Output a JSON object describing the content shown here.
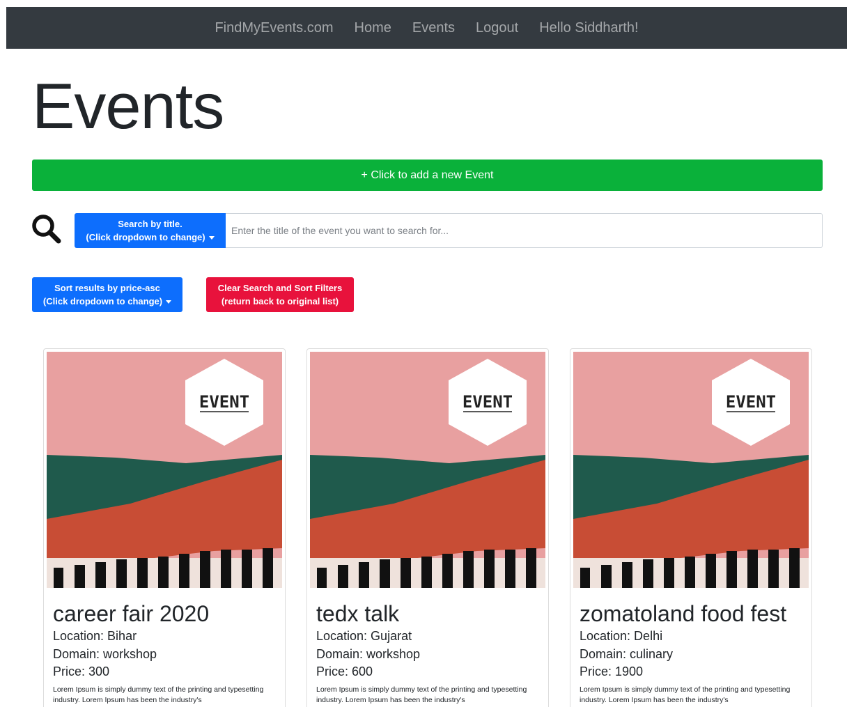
{
  "navbar": {
    "brand": "FindMyEvents.com",
    "links": [
      "Home",
      "Events",
      "Logout"
    ],
    "greeting": "Hello Siddharth!"
  },
  "page": {
    "title": "Events",
    "add_button_label": "+ Click to add a new Event"
  },
  "search": {
    "icon": "search-icon",
    "dropdown_line1": "Search by title.",
    "dropdown_line2": "(Click dropdown to change)",
    "placeholder": "Enter the title of the event you want to search for..."
  },
  "sort": {
    "line1": "Sort results by price-asc",
    "line2": "(Click dropdown to change)"
  },
  "clear": {
    "line1": "Clear Search and Sort Filters",
    "line2": "(return back to original list)"
  },
  "events": [
    {
      "image_badge": "EVENT",
      "title": "career fair 2020",
      "location": "Location: Bihar",
      "domain": "Domain: workshop",
      "price": "Price: 300",
      "description": "Lorem Ipsum is simply dummy text of the printing and typesetting industry. Lorem Ipsum has been the industry's"
    },
    {
      "image_badge": "EVENT",
      "title": "tedx talk",
      "location": "Location: Gujarat",
      "domain": "Domain: workshop",
      "price": "Price: 600",
      "description": "Lorem Ipsum is simply dummy text of the printing and typesetting industry. Lorem Ipsum has been the industry's"
    },
    {
      "image_badge": "EVENT",
      "title": "zomatoland food fest",
      "location": "Location: Delhi",
      "domain": "Domain: culinary",
      "price": "Price: 1900",
      "description": "Lorem Ipsum is simply dummy text of the printing and typesetting industry. Lorem Ipsum has been the industry's"
    }
  ],
  "colors": {
    "navbar_bg": "#343a40",
    "add_button": "#0ab13a",
    "primary": "#0d6efd",
    "danger": "#e8123c",
    "poster_pink": "#e8a0a0",
    "poster_green": "#1f5a4c",
    "poster_red": "#c84d35"
  }
}
